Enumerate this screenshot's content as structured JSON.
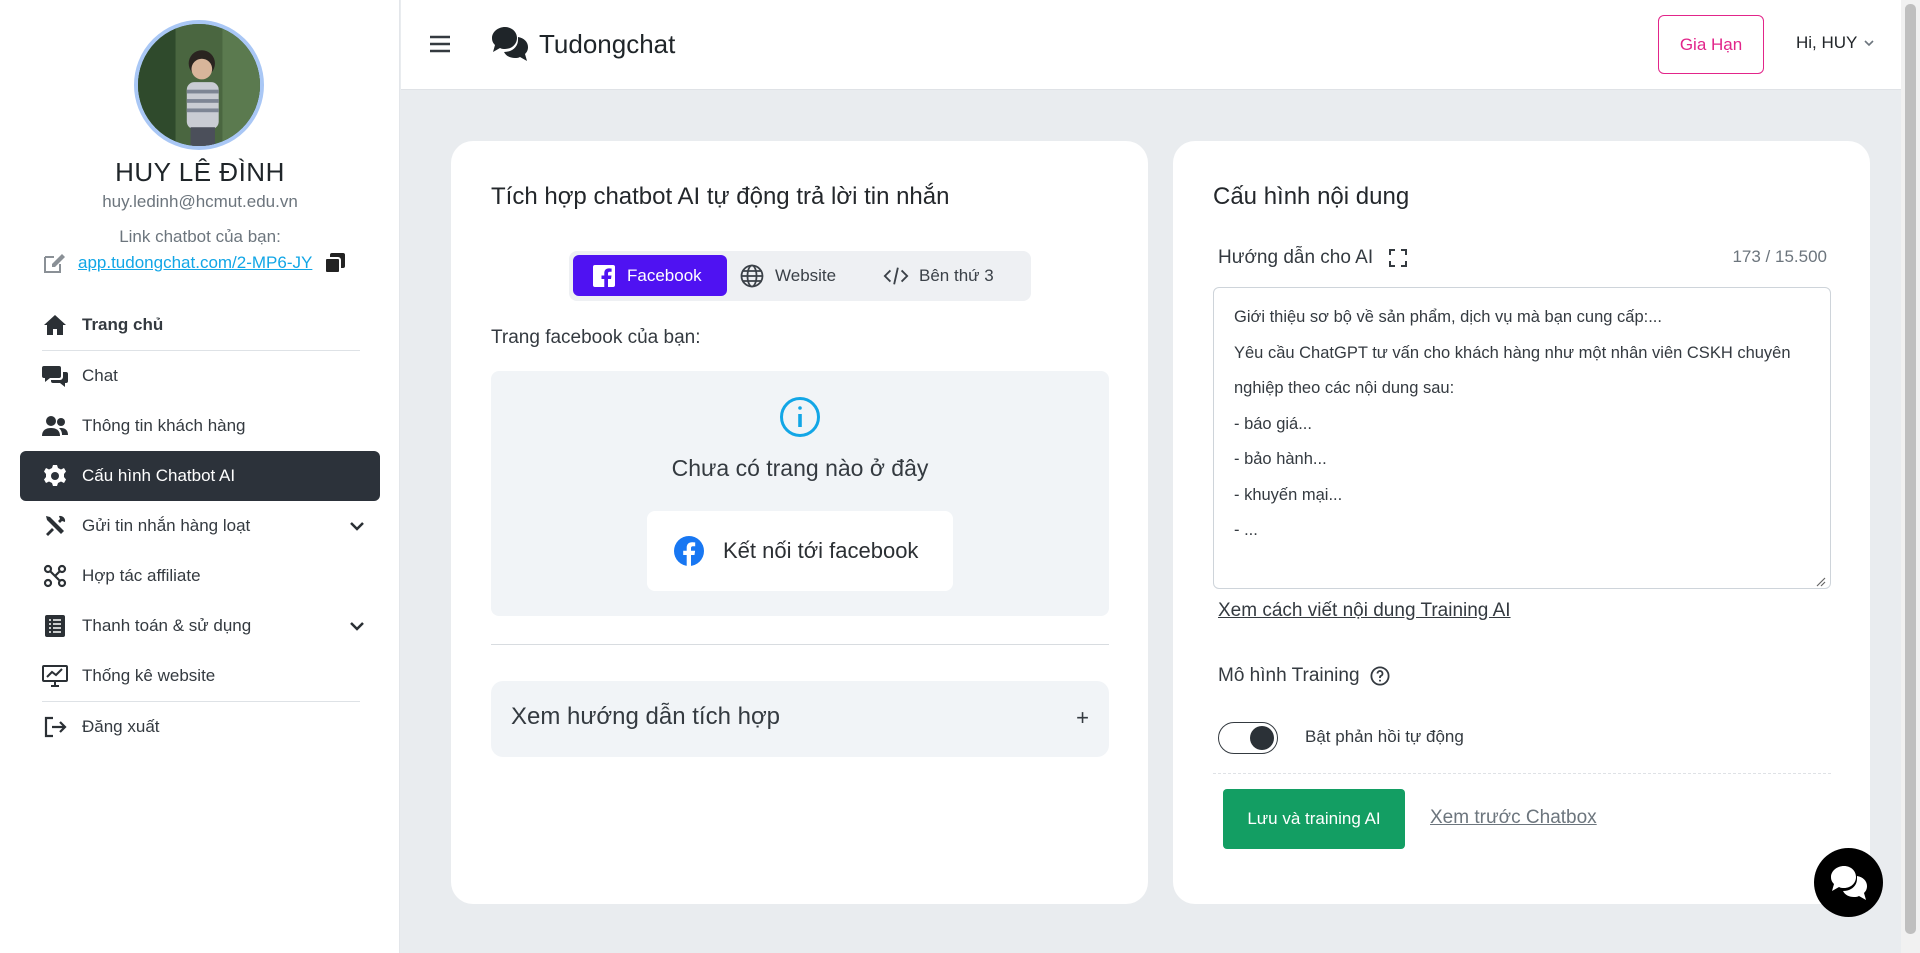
{
  "user": {
    "name": "HUY LÊ ĐÌNH",
    "email": "huy.ledinh@hcmut.edu.vn",
    "link_label": "Link chatbot của bạn:",
    "link_url": "app.tudongchat.com/2-MP6-JY"
  },
  "sidebar": {
    "items": [
      {
        "label": "Trang chủ",
        "icon": "home-icon"
      },
      {
        "label": "Chat",
        "icon": "chat-bubbles-icon"
      },
      {
        "label": "Thông tin khách hàng",
        "icon": "users-icon"
      },
      {
        "label": "Cấu hình Chatbot AI",
        "icon": "gear-icon",
        "active": true
      },
      {
        "label": "Gửi tin nhắn hàng loạt",
        "icon": "tools-icon",
        "expandable": true
      },
      {
        "label": "Hợp tác affiliate",
        "icon": "affiliate-icon"
      },
      {
        "label": "Thanh toán & sử dụng",
        "icon": "receipt-icon",
        "expandable": true
      },
      {
        "label": "Thống kê website",
        "icon": "chart-monitor-icon"
      },
      {
        "label": "Đăng xuất",
        "icon": "logout-icon"
      }
    ]
  },
  "topbar": {
    "brand": "Tudongchat",
    "renew_label": "Gia Hạn",
    "greeting": "Hi, HUY"
  },
  "integration": {
    "title": "Tích hợp chatbot AI tự động trả lời tin nhắn",
    "tabs": [
      {
        "label": "Facebook",
        "icon": "facebook-icon",
        "active": true
      },
      {
        "label": "Website",
        "icon": "globe-icon"
      },
      {
        "label": "Bên thứ 3",
        "icon": "code-icon"
      }
    ],
    "fb_page_label": "Trang facebook của bạn:",
    "empty_text": "Chưa có trang nào ở đây",
    "connect_label": "Kết nối tới facebook",
    "guide_label": "Xem hướng dẫn tích hợp",
    "guide_toggle": "+"
  },
  "content_config": {
    "title": "Cấu hình nội dung",
    "ai_label": "Hướng dẫn cho AI",
    "char_count": "173 / 15.500",
    "instructions": "Giới thiệu sơ bộ về sản phẩm, dịch vụ mà bạn cung cấp:...\nYêu cầu ChatGPT tư vấn cho khách hàng như một nhân viên CSKH chuyên nghiệp theo các nội dung sau:\n- báo giá...\n- bảo hành...\n- khuyến mại...\n- ...",
    "training_link": "Xem cách viết nội dung Training AI",
    "model_label": "Mô hình Training",
    "auto_reply_label": "Bật phản hồi tự động",
    "auto_reply_on": true,
    "save_label": "Lưu và training AI",
    "preview_label": "Xem trước Chatbox"
  },
  "colors": {
    "accent": "#4f12f2",
    "renew": "#e2258a",
    "save": "#139e63",
    "active_nav": "#2c323a",
    "info": "#12a6e6"
  }
}
